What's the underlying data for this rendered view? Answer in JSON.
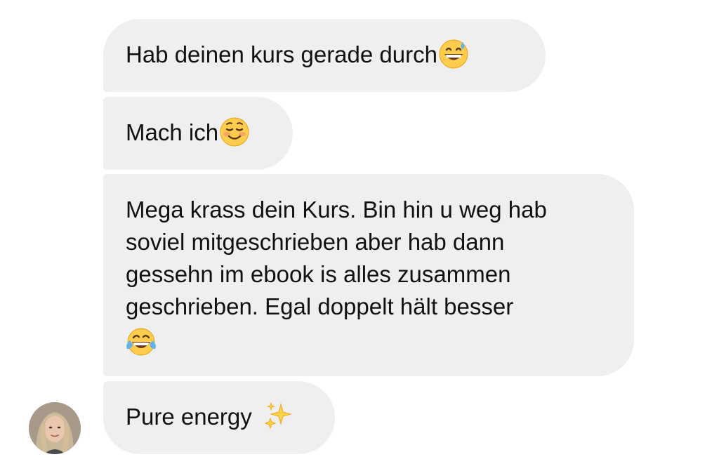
{
  "messages": [
    {
      "text": "Hab deinen kurs gerade durch",
      "emoji": "grinning-sweat-emoji"
    },
    {
      "text": "Mach ich",
      "emoji": "smiling-blush-emoji"
    },
    {
      "lines": [
        "Mega krass dein Kurs. Bin hin u weg hab",
        "soviel mitgeschrieben aber hab dann",
        "gessehn im ebook is alles zusammen",
        "geschrieben. Egal doppelt hält besser"
      ],
      "emoji": "tears-of-joy-emoji"
    },
    {
      "text": "Pure energy",
      "emoji": "sparkles-emoji"
    }
  ],
  "colors": {
    "bubble": "#efefef",
    "text": "#111111",
    "emoji_yellow": "#ffcc4d"
  }
}
